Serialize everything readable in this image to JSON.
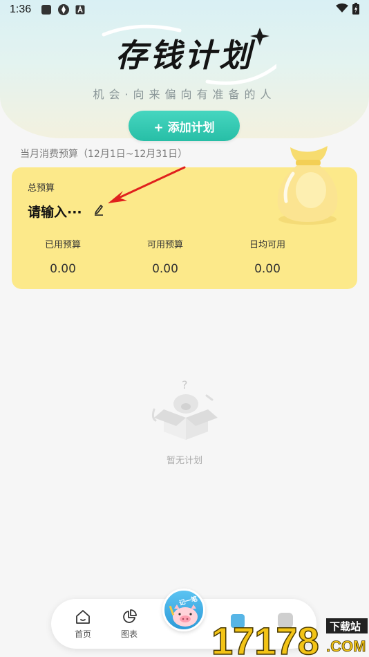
{
  "status_bar": {
    "time": "1:36",
    "icons": [
      "square-icon",
      "aperture-icon",
      "a-icon",
      "wifi-icon",
      "battery-icon"
    ]
  },
  "header": {
    "title": "存钱计划",
    "subtitle": "机会·向来偏向有准备的人",
    "add_button": "+ 添加计划"
  },
  "budget": {
    "period": "当月消费预算（12月1日~12月31日）",
    "total_label": "总预算",
    "amount_placeholder": "请输入···",
    "stats": [
      {
        "label": "已用预算",
        "value": "0.00"
      },
      {
        "label": "可用预算",
        "value": "0.00"
      },
      {
        "label": "日均可用",
        "value": "0.00"
      }
    ]
  },
  "empty_state": {
    "text": "暂无计划"
  },
  "nav": {
    "items": [
      {
        "label": "首页",
        "icon": "home-icon"
      },
      {
        "label": "图表",
        "icon": "pie-chart-icon"
      }
    ],
    "fab_label": "记一笔"
  },
  "watermark": {
    "number": "17178",
    "tag": "下载站",
    "suffix": ".COM"
  },
  "colors": {
    "accent": "#2ec4ad",
    "card": "#fce98a",
    "arrow": "#e0201d",
    "fab": "#3aa8e2"
  }
}
